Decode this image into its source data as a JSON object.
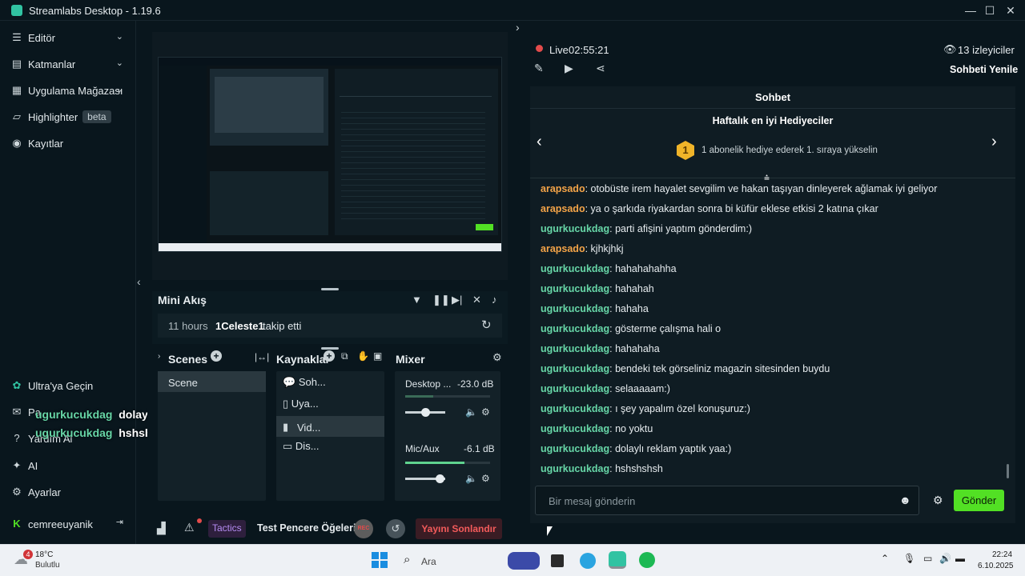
{
  "window": {
    "title": "Streamlabs Desktop - 1.19.6"
  },
  "sidebar": {
    "items": [
      {
        "label": "Editör",
        "icon": "sliders-icon"
      },
      {
        "label": "Katmanlar",
        "icon": "layers-icon"
      },
      {
        "label": "Uygulama Mağazası",
        "icon": "store-icon"
      },
      {
        "label": "Highlighter",
        "badge": "beta",
        "icon": "highlighter-icon"
      },
      {
        "label": "Kayıtlar",
        "icon": "record-icon"
      }
    ],
    "bottom_items": [
      {
        "label": "Ultra'ya Geçin",
        "icon": "ultra-icon"
      },
      {
        "label": "Pa",
        "icon": "gift-icon"
      },
      {
        "label": "Yardım Al",
        "icon": "help-icon"
      },
      {
        "label": "AI",
        "icon": "ai-sparkle-icon"
      },
      {
        "label": "Ayarlar",
        "icon": "gear-icon"
      }
    ],
    "user": "cemreeuyanik"
  },
  "overlay_chat": [
    {
      "user": "ugurkucukdag",
      "msg": "dolaylı reklam yaptık yaa:)"
    },
    {
      "user": "ugurkucukdag",
      "msg": "hshshshsh"
    }
  ],
  "mini_akis": {
    "title": "Mini Akış",
    "time": "11 hours",
    "user": "1Celeste1",
    "action": "takip etti"
  },
  "scenes": {
    "title": "Scenes",
    "items": [
      "Scene"
    ]
  },
  "sources": {
    "title": "Kaynaklar",
    "items": [
      "Soh...",
      "Uya...",
      "Vid...",
      "Dis..."
    ]
  },
  "mixer": {
    "title": "Mixer",
    "channels": [
      {
        "name": "Desktop ...",
        "db": "-23.0 dB",
        "level": 0.33
      },
      {
        "name": "Mic/Aux",
        "db": "-6.1 dB",
        "level": 0.7
      }
    ]
  },
  "statusbar": {
    "tactics": "Tactics",
    "test_label": "Test Pencere Öğeleri",
    "rec": "REC",
    "end_stream": "Yayını Sonlandır"
  },
  "stream": {
    "live_label": "Live",
    "timer": "02:55:21",
    "viewers": "13 izleyiciler",
    "refresh_chat": "Sohbeti Yenile"
  },
  "chat": {
    "header": "Sohbet",
    "top_gifters_title": "Haftalık en iyi Hediyeciler",
    "rank": "1",
    "top_gifters_msg": "1 abonelik hediye ederek 1. sıraya yükselin",
    "messages": [
      {
        "user": "arapsado",
        "color": "orange",
        "msg": "otobüste irem hayalet sevgilim ve hakan taşıyan dinleyerek ağlamak iyi geliyor"
      },
      {
        "user": "arapsado",
        "color": "orange",
        "msg": "ya o şarkıda riyakardan sonra bi küfür eklese etkisi 2 katına çıkar"
      },
      {
        "user": "ugurkucukdag",
        "color": "green",
        "msg": "parti afişini yaptım gönderdim:)"
      },
      {
        "user": "arapsado",
        "color": "orange",
        "msg": "kjhkjhkj"
      },
      {
        "user": "ugurkucukdag",
        "color": "green",
        "msg": "hahahahahha"
      },
      {
        "user": "ugurkucukdag",
        "color": "green",
        "msg": "hahahah"
      },
      {
        "user": "ugurkucukdag",
        "color": "green",
        "msg": "hahaha"
      },
      {
        "user": "ugurkucukdag",
        "color": "green",
        "msg": "gösterme çalışma hali o"
      },
      {
        "user": "ugurkucukdag",
        "color": "green",
        "msg": "hahahaha"
      },
      {
        "user": "ugurkucukdag",
        "color": "green",
        "msg": "bendeki tek görseliniz magazin sitesinden buydu"
      },
      {
        "user": "ugurkucukdag",
        "color": "green",
        "msg": "selaaaaam:)"
      },
      {
        "user": "ugurkucukdag",
        "color": "green",
        "msg": "ı şey yapalım özel konuşuruz:)"
      },
      {
        "user": "ugurkucukdag",
        "color": "green",
        "msg": "no yoktu"
      },
      {
        "user": "ugurkucukdag",
        "color": "green",
        "msg": "dolaylı reklam yaptık yaa:)"
      },
      {
        "user": "ugurkucukdag",
        "color": "green",
        "msg": "hshshshsh"
      }
    ],
    "input_placeholder": "Bir mesaj gönderin",
    "send_label": "Gönder"
  },
  "taskbar": {
    "weather_temp": "18°C",
    "weather_desc": "Bulutlu",
    "weather_badge": "4",
    "search_placeholder": "Ara",
    "time": "22:24",
    "date": "6.10.2025"
  },
  "colors": {
    "accent_green": "#31c3a2",
    "send_button": "#52e024",
    "end_stream": "#e34b4b",
    "username_orange": "#f4a448",
    "username_green": "#67d6a7"
  }
}
